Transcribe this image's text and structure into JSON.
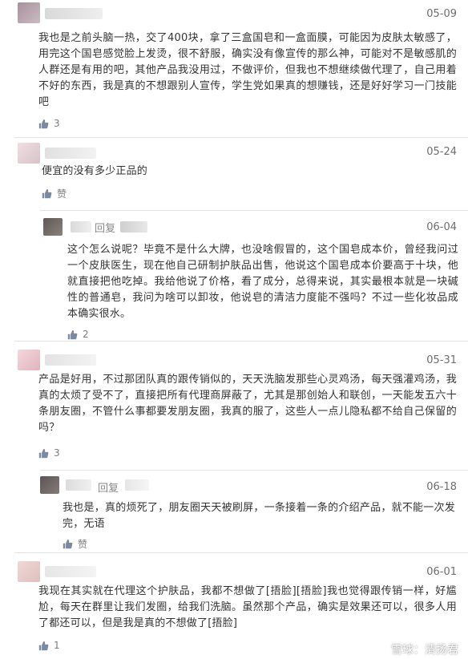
{
  "comments": [
    {
      "date": "05-09",
      "text": "我也是之前头脑一热，交了400块，拿了三盒国皂和一盒面膜，可能因为皮肤太敏感了，用完这个国皂感觉脸上发烫，很不舒服，确实没有像宣传的那么神，可能对不是敏感肌的人群还是有用的吧，其他产品我没用过，不做评价，但我也不想继续做代理了，自己用着不好的东西，我是真的不想跟别人宣传，学生党如果真的想赚钱，还是好好学习一门技能吧",
      "likes": "3"
    },
    {
      "date": "05-24",
      "text": "便宜的没有多少正品的",
      "likes": "赞",
      "reply": {
        "label": "回复",
        "date": "06-04",
        "text": "这个怎么说呢？毕竟不是什么大牌，也没啥假冒的，这个国皂成本价，曾经我问过一个皮肤医生，现在他自己研制护肤品出售，他说这个国皂成本价要高于十块，他就直接把他吃掉。我给他说了价格，看了成分，总得来说，其实最根本就是一块碱性的普通皂，我问为啥可以卸妆，他说皂的清洁力度能不强吗？不过一些化妆品成本确实很水。",
        "likes": "2"
      }
    },
    {
      "date": "05-31",
      "text": "产品是好用，不过那团队真的跟传销似的，天天洗脑发那些心灵鸡汤，每天强灌鸡汤，我真的太烦了受不了，直接把所有代理商屏蔽了，尤其是那创始人和联创，一天能发五六十条朋友圈，不管什么事都要发朋友圈，我真的服了，这些人一点儿隐私都不给自己保留的吗？",
      "likes": "3",
      "reply": {
        "label": "回复",
        "date": "06-18",
        "text": "我也是，真的烦死了，朋友圈天天被刷屏，一条接着一条的介绍产品，就不能一次发完，无语",
        "likes": "赞"
      }
    },
    {
      "date": "06-01",
      "text": "我现在其实就在代理这个护肤品，我都不想做了[捂脸][捂脸]我也觉得跟传销一样，好尴尬，每天在群里让我们发圈，给我们洗脑。虽然那个产品，确实是效果还可以，很多人用了都还可以，但是我是真的不想做了[捂脸]",
      "likes": "1"
    }
  ],
  "watermark": "雪球：清扬君",
  "colors": {
    "avatar1": "#b9a9b2",
    "avatar2": "#e3c9cf",
    "avatar3": "#6f6a66",
    "avatar4": "#e8c6cc",
    "avatar5": "#6b6363",
    "avatar6": "#ead2d0"
  }
}
